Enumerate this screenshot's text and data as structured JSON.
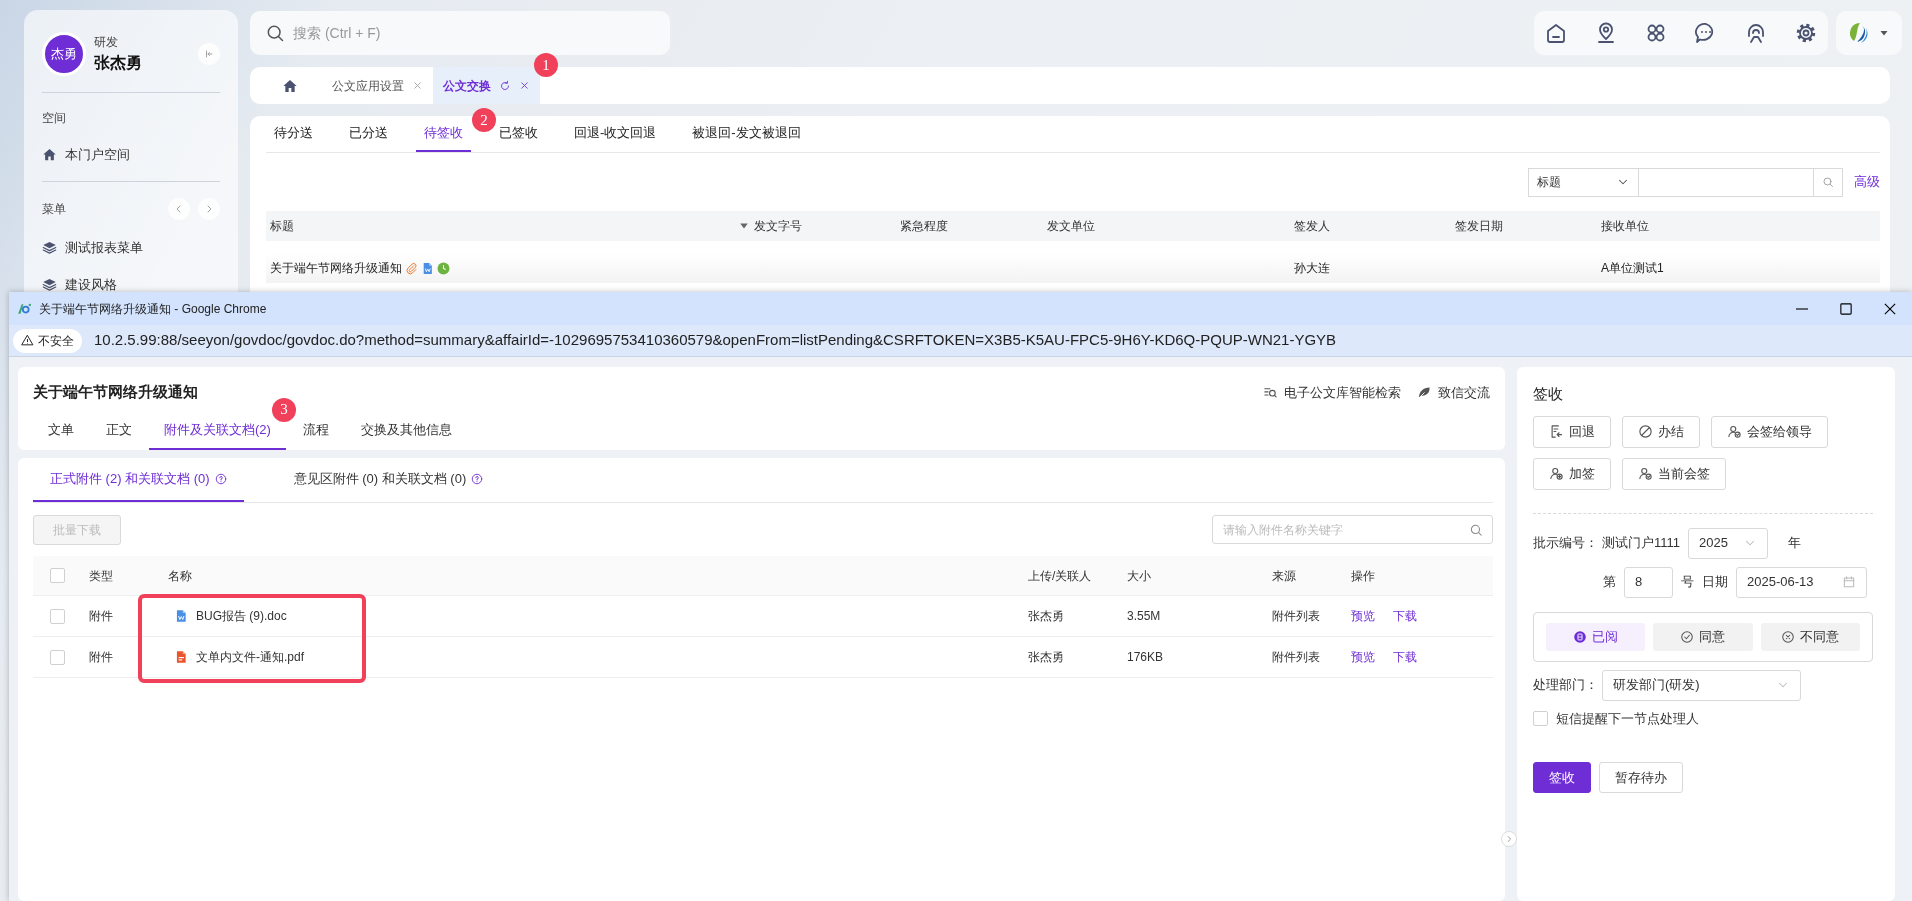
{
  "sidebar": {
    "user": {
      "avatar_text": "杰勇",
      "department": "研发",
      "name": "张杰勇"
    },
    "sections": [
      {
        "title": "空间",
        "items": [
          {
            "label": "本门户空间",
            "kind": "home"
          }
        ]
      },
      {
        "title": "菜单",
        "items": [
          {
            "label": "测试报表菜单",
            "kind": "layers"
          },
          {
            "label": "建设风格",
            "kind": "layers"
          }
        ]
      }
    ]
  },
  "search": {
    "placeholder": "搜索 (Ctrl + F)"
  },
  "toolbar": [
    {
      "kind": "home"
    },
    {
      "kind": "pin"
    },
    {
      "kind": "grid"
    },
    {
      "kind": "chat"
    },
    {
      "kind": "headset"
    },
    {
      "kind": "gear"
    }
  ],
  "page_tabs": [
    {
      "label": "公文应用设置",
      "selected": false
    },
    {
      "label": "公文交换",
      "selected": true,
      "badge": "1"
    }
  ],
  "doc_tabs": [
    {
      "label": "待分送",
      "selected": false
    },
    {
      "label": "已分送",
      "selected": false
    },
    {
      "label": "待签收",
      "selected": true,
      "badge": "2"
    },
    {
      "label": "已签收",
      "selected": false
    },
    {
      "label": "回退-收文回退",
      "selected": false
    },
    {
      "label": "被退回-发文被退回",
      "selected": false
    }
  ],
  "filter": {
    "field": "标题",
    "link": "高级"
  },
  "list_table": {
    "columns": [
      "标题",
      "发文字号",
      "紧急程度",
      "发文单位",
      "签发人",
      "签发日期",
      "接收单位"
    ],
    "rows": [
      {
        "title": "关于端午节网络升级通知",
        "signer": "孙大连",
        "receiver": "A单位测试1"
      }
    ]
  },
  "browser": {
    "title": "关于端午节网络升级通知 - Google Chrome",
    "security": "不安全",
    "url": "10.2.5.99:88/seeyon/govdoc/govdoc.do?method=summary&affairId=-1029695753410360579&openFrom=listPending&CSRFTOKEN=X3B5-K5AU-FPC5-9H6Y-KD6Q-PQUP-WN21-YGYB"
  },
  "document": {
    "title": "关于端午节网络升级通知",
    "actions": [
      {
        "label": "电子公文库智能检索",
        "kind": "search"
      },
      {
        "label": "致信交流",
        "kind": "chat"
      }
    ],
    "tabs": [
      {
        "label": "文单",
        "selected": false
      },
      {
        "label": "正文",
        "selected": false
      },
      {
        "label": "附件及关联文档(2)",
        "selected": true,
        "badge": "3"
      },
      {
        "label": "流程",
        "selected": false
      },
      {
        "label": "交换及其他信息",
        "selected": false
      }
    ]
  },
  "attachments": {
    "tabs": [
      {
        "label": "正式附件 (2) 和关联文档 (0)",
        "selected": true
      },
      {
        "label": "意见区附件 (0) 和关联文档 (0)",
        "selected": false
      }
    ],
    "bulk_download": {
      "label": "批量下载",
      "disabled": true
    },
    "search": {
      "placeholder": "请输入附件名称关键字"
    },
    "columns": [
      "类型",
      "名称",
      "上传/关联人",
      "大小",
      "来源",
      "操作"
    ],
    "names_highlighted": true,
    "all_checked": false,
    "rows": [
      {
        "checked": false,
        "type": "附件",
        "name": "BUG报告 (9).doc",
        "kind": "word",
        "uploader": "张杰勇",
        "size": "3.55M",
        "source": "附件列表",
        "actions": [
          "预览",
          "下载"
        ]
      },
      {
        "checked": false,
        "type": "附件",
        "name": "文单内文件-通知.pdf",
        "kind": "pdf",
        "uploader": "张杰勇",
        "size": "176KB",
        "source": "附件列表",
        "actions": [
          "预览",
          "下载"
        ]
      }
    ]
  },
  "sign_panel": {
    "title": "签收",
    "actions": [
      {
        "label": "回退",
        "kind": "return"
      },
      {
        "label": "办结",
        "kind": "finish"
      },
      {
        "label": "会签给领导",
        "kind": "countersign"
      },
      {
        "label": "加签",
        "kind": "add"
      },
      {
        "label": "当前会签",
        "kind": "countersign"
      }
    ],
    "number": {
      "label": "批示编号：",
      "prefix": "测试门户1111",
      "year": "2025",
      "year_unit": "年",
      "seq_label": "第",
      "seq": "8",
      "seq_unit": "号",
      "date_label": "日期",
      "date": "2025-06-13"
    },
    "opinions": [
      {
        "label": "已阅",
        "kind": "read",
        "selected": true
      },
      {
        "label": "同意",
        "kind": "agree",
        "selected": false
      },
      {
        "label": "不同意",
        "kind": "disagree",
        "selected": false
      }
    ],
    "department": {
      "label": "处理部门：",
      "value": "研发部门(研发)"
    },
    "sms": {
      "label": "短信提醒下一节点处理人",
      "checked": false
    },
    "buttons": [
      {
        "label": "签收",
        "kind": "primary"
      },
      {
        "label": "暂存待办",
        "kind": "secondary"
      }
    ]
  }
}
